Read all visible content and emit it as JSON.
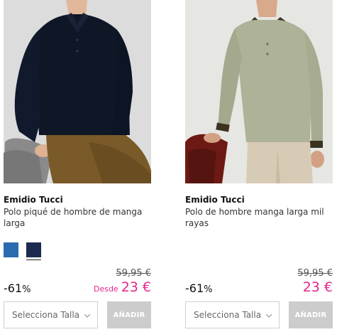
{
  "products": [
    {
      "brand": "Emidio Tucci",
      "name": "Polo piqué de hombre de manga larga",
      "image": "navy-polo-photo",
      "swatches": [
        {
          "color": "#2a6bb0",
          "name": "blue"
        },
        {
          "color": "#1d2a4f",
          "name": "navy"
        }
      ],
      "selected_swatch": 1,
      "old_price": "59,95 €",
      "discount": "-61",
      "discount_unit": "%",
      "from_label": "Desde",
      "price": "23 €",
      "size_placeholder": "Selecciona Talla",
      "add_label": "AÑADIR"
    },
    {
      "brand": "Emidio Tucci",
      "name": "Polo de hombre manga larga mil rayas",
      "image": "striped-polo-photo",
      "swatches": [],
      "old_price": "59,95 €",
      "discount": "-61",
      "discount_unit": "%",
      "price": "23 €",
      "size_placeholder": "Selecciona Talla",
      "add_label": "AÑADIR"
    }
  ],
  "colors": {
    "sale_price": "#e6268a",
    "add_button_bg": "#cccccc"
  }
}
